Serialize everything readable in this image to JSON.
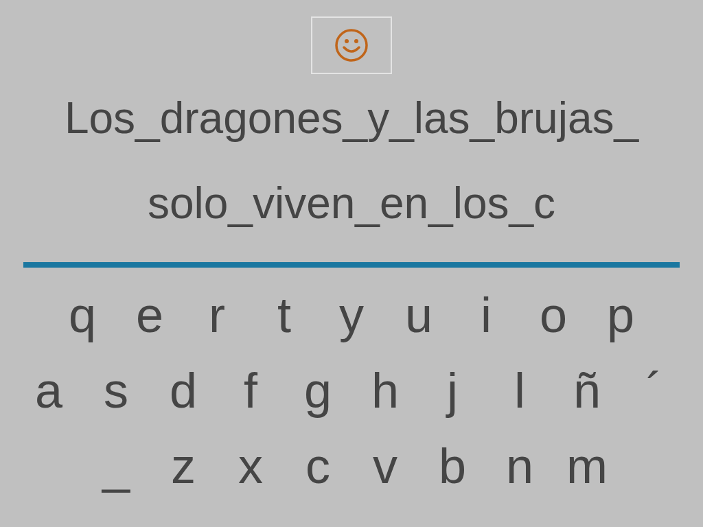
{
  "sentence_lines": [
    "Los_dragones_y_las_brujas_",
    "solo_viven_en_los_c"
  ],
  "keyboard_rows": [
    [
      "q",
      "e",
      "r",
      "t",
      "y",
      "u",
      "i",
      "o",
      "p"
    ],
    [
      "a",
      "s",
      "d",
      "f",
      "g",
      "h",
      "j",
      "l",
      "ñ",
      "´"
    ],
    [
      "_",
      "z",
      "x",
      "c",
      "v",
      "b",
      "n",
      "m"
    ]
  ]
}
